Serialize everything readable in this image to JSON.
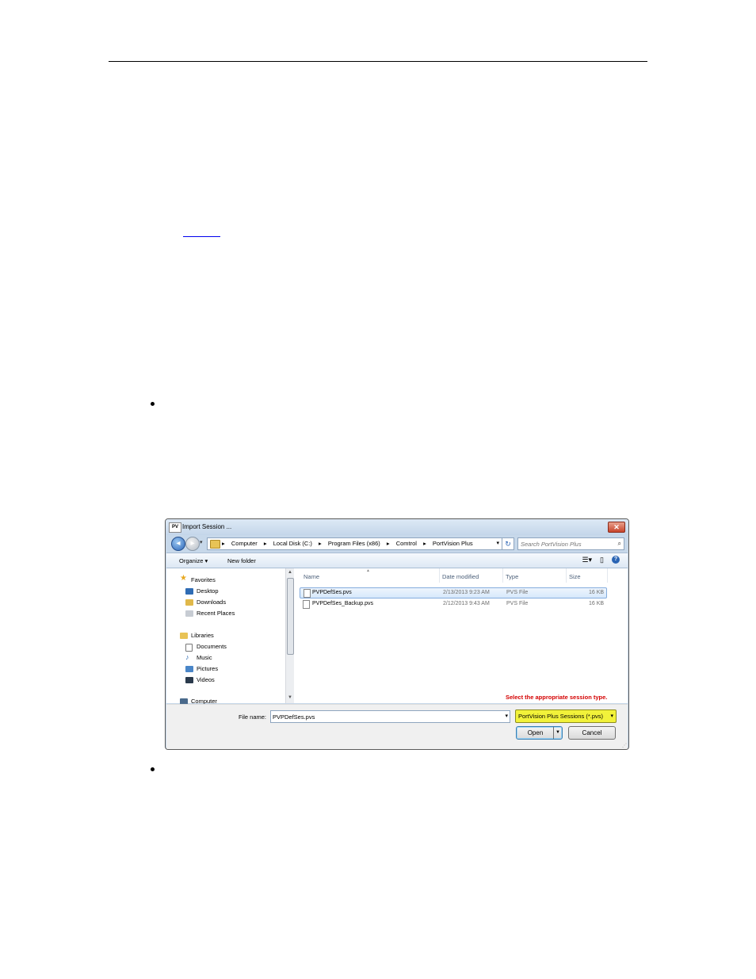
{
  "dialog": {
    "title": "Import Session ...",
    "app_icon_text": "PV",
    "close_glyph": "✕",
    "address": {
      "crumbs": [
        "Computer",
        "Local Disk (C:)",
        "Program Files (x86)",
        "Comtrol",
        "PortVision Plus"
      ],
      "separator": "▸"
    },
    "search": {
      "placeholder": "Search PortVision Plus"
    },
    "toolbar": {
      "organize": "Organize ▾",
      "new_folder": "New folder"
    },
    "nav": {
      "favorites": "Favorites",
      "desktop": "Desktop",
      "downloads": "Downloads",
      "recent_places": "Recent Places",
      "libraries": "Libraries",
      "documents": "Documents",
      "music": "Music",
      "pictures": "Pictures",
      "videos": "Videos",
      "computer": "Computer"
    },
    "columns": {
      "name": "Name",
      "date": "Date modified",
      "type": "Type",
      "size": "Size"
    },
    "files": [
      {
        "name": "PVPDefSes.pvs",
        "date": "2/13/2013 9:23 AM",
        "type": "PVS File",
        "size": "16 KB",
        "selected": true
      },
      {
        "name": "PVPDefSes_Backup.pvs",
        "date": "2/12/2013 9:43 AM",
        "type": "PVS File",
        "size": "16 KB",
        "selected": false
      }
    ],
    "annotation": "Select the appropriate session type.",
    "file_name_label": "File name:",
    "file_name_value": "PVPDefSes.pvs",
    "file_type": "PortVision Plus Sessions (*.pvs)",
    "open_label": "Open",
    "cancel_label": "Cancel"
  },
  "colors": {
    "annotation": "#d40000",
    "type_highlight": "#f2f23a",
    "selection_border": "#84acdd"
  }
}
